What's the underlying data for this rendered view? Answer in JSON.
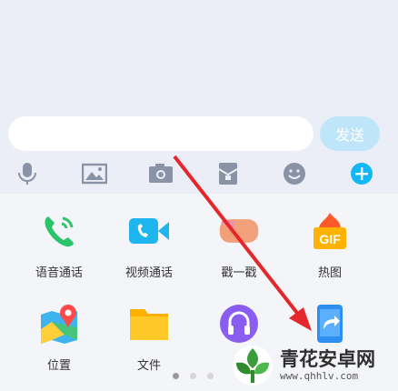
{
  "input": {
    "value": "",
    "placeholder": ""
  },
  "send_label": "发送",
  "toolbar": {
    "icons": [
      "microphone-icon",
      "image-icon",
      "camera-icon",
      "red-packet-icon",
      "emoji-icon",
      "plus-icon"
    ]
  },
  "apps": [
    {
      "label": "语音通话",
      "icon": "phone-icon",
      "color": "#2bc46b"
    },
    {
      "label": "视频通话",
      "icon": "video-icon",
      "color": "#1fb6f0"
    },
    {
      "label": "戳一戳",
      "icon": "poke-icon",
      "color": "#f2a07a"
    },
    {
      "label": "热图",
      "icon": "gif-icon",
      "color": "#ffb300"
    },
    {
      "label": "位置",
      "icon": "location-icon",
      "color": "#3a8df0"
    },
    {
      "label": "文件",
      "icon": "folder-icon",
      "color": "#ffc21a"
    },
    {
      "label": "",
      "icon": "music-icon",
      "color": "#8a5cf0"
    },
    {
      "label": "",
      "icon": "screen-share-icon",
      "color": "#2f8ff0"
    }
  ],
  "pager": {
    "pages": 3,
    "active": 1
  },
  "watermark": {
    "title": "青花安卓网",
    "url": "www.qhhlv.com"
  },
  "colors": {
    "accent": "#12b7f5",
    "send_disabled": "#bfe5fa",
    "arrow": "#e5262a"
  }
}
